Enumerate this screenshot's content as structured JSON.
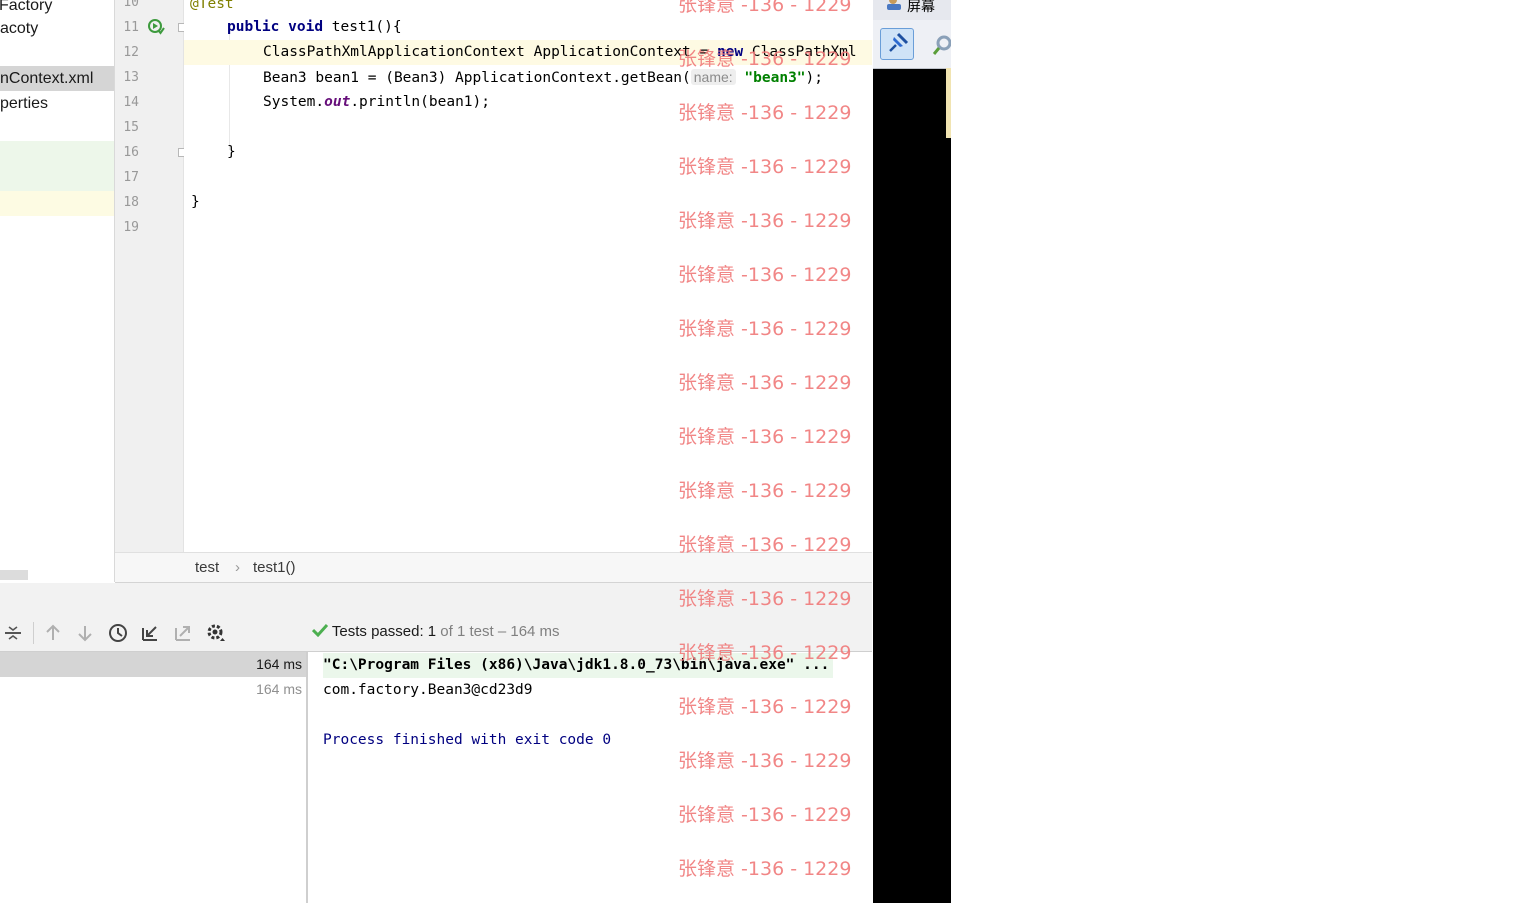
{
  "project_tree": {
    "items": [
      {
        "label": "Factory"
      },
      {
        "label": "acoty"
      },
      {
        "label": "nContext.xml",
        "selected": true
      },
      {
        "label": "perties"
      }
    ]
  },
  "editor": {
    "lines": [
      {
        "n": "10",
        "code": "@Test"
      },
      {
        "n": "11",
        "code": "public void test1(){"
      },
      {
        "n": "12",
        "code": "ClassPathXmlApplicationContext ApplicationContext = new ClassPathXml"
      },
      {
        "n": "13",
        "code": "Bean3 bean1 = (Bean3) ApplicationContext.getBean( name: \"bean3\");"
      },
      {
        "n": "14",
        "code": "System.out.println(bean1);"
      },
      {
        "n": "15",
        "code": ""
      },
      {
        "n": "16",
        "code": "}"
      },
      {
        "n": "17",
        "code": ""
      },
      {
        "n": "18",
        "code": "}"
      },
      {
        "n": "19",
        "code": ""
      }
    ],
    "tokens": {
      "annotation": "@Test",
      "kw_public": "public",
      "kw_void": "void",
      "method_sig": " test1(){",
      "ctx_decl": "ClassPathXmlApplicationContext ApplicationContext = ",
      "kw_new": "new",
      "ctx_ctor": " ClassPathXml",
      "bean_cast": "Bean3 bean1 = (Bean3) ApplicationContext.getBean(",
      "hint_name": "name:",
      "bean_str": "\"bean3\"",
      "bean_end": ");",
      "sys_prefix": "System.",
      "sys_out": "out",
      "sys_suffix": ".println(bean1);",
      "close_brace": "}"
    }
  },
  "breadcrumbs": {
    "items": [
      "test",
      "test1()"
    ],
    "separator": "›"
  },
  "run_panel": {
    "status": {
      "prefix": "Tests passed: ",
      "count": "1",
      "suffix": " of 1 test – 164 ms"
    },
    "test_rows": [
      {
        "time": "164 ms",
        "selected": true
      },
      {
        "time": "164 ms",
        "selected": false
      }
    ],
    "console": [
      {
        "text": "\"C:\\Program Files (x86)\\Java\\jdk1.8.0_73\\bin\\java.exe\" ...",
        "kind": "cmd"
      },
      {
        "text": "com.factory.Bean3@cd23d9",
        "kind": "out"
      },
      {
        "text": "",
        "kind": "out"
      },
      {
        "text": "Process finished with exit code 0",
        "kind": "sys"
      }
    ]
  },
  "watermark": {
    "text": "张锋意 -136 - 1229",
    "count": 17
  },
  "side_window": {
    "title": "屏幕"
  },
  "colors": {
    "keyword": "#000080",
    "string": "#008000",
    "annotation": "#808000",
    "watermark": "#f07a7a",
    "current_line": "#fefae3",
    "success_check": "#4caf50"
  }
}
